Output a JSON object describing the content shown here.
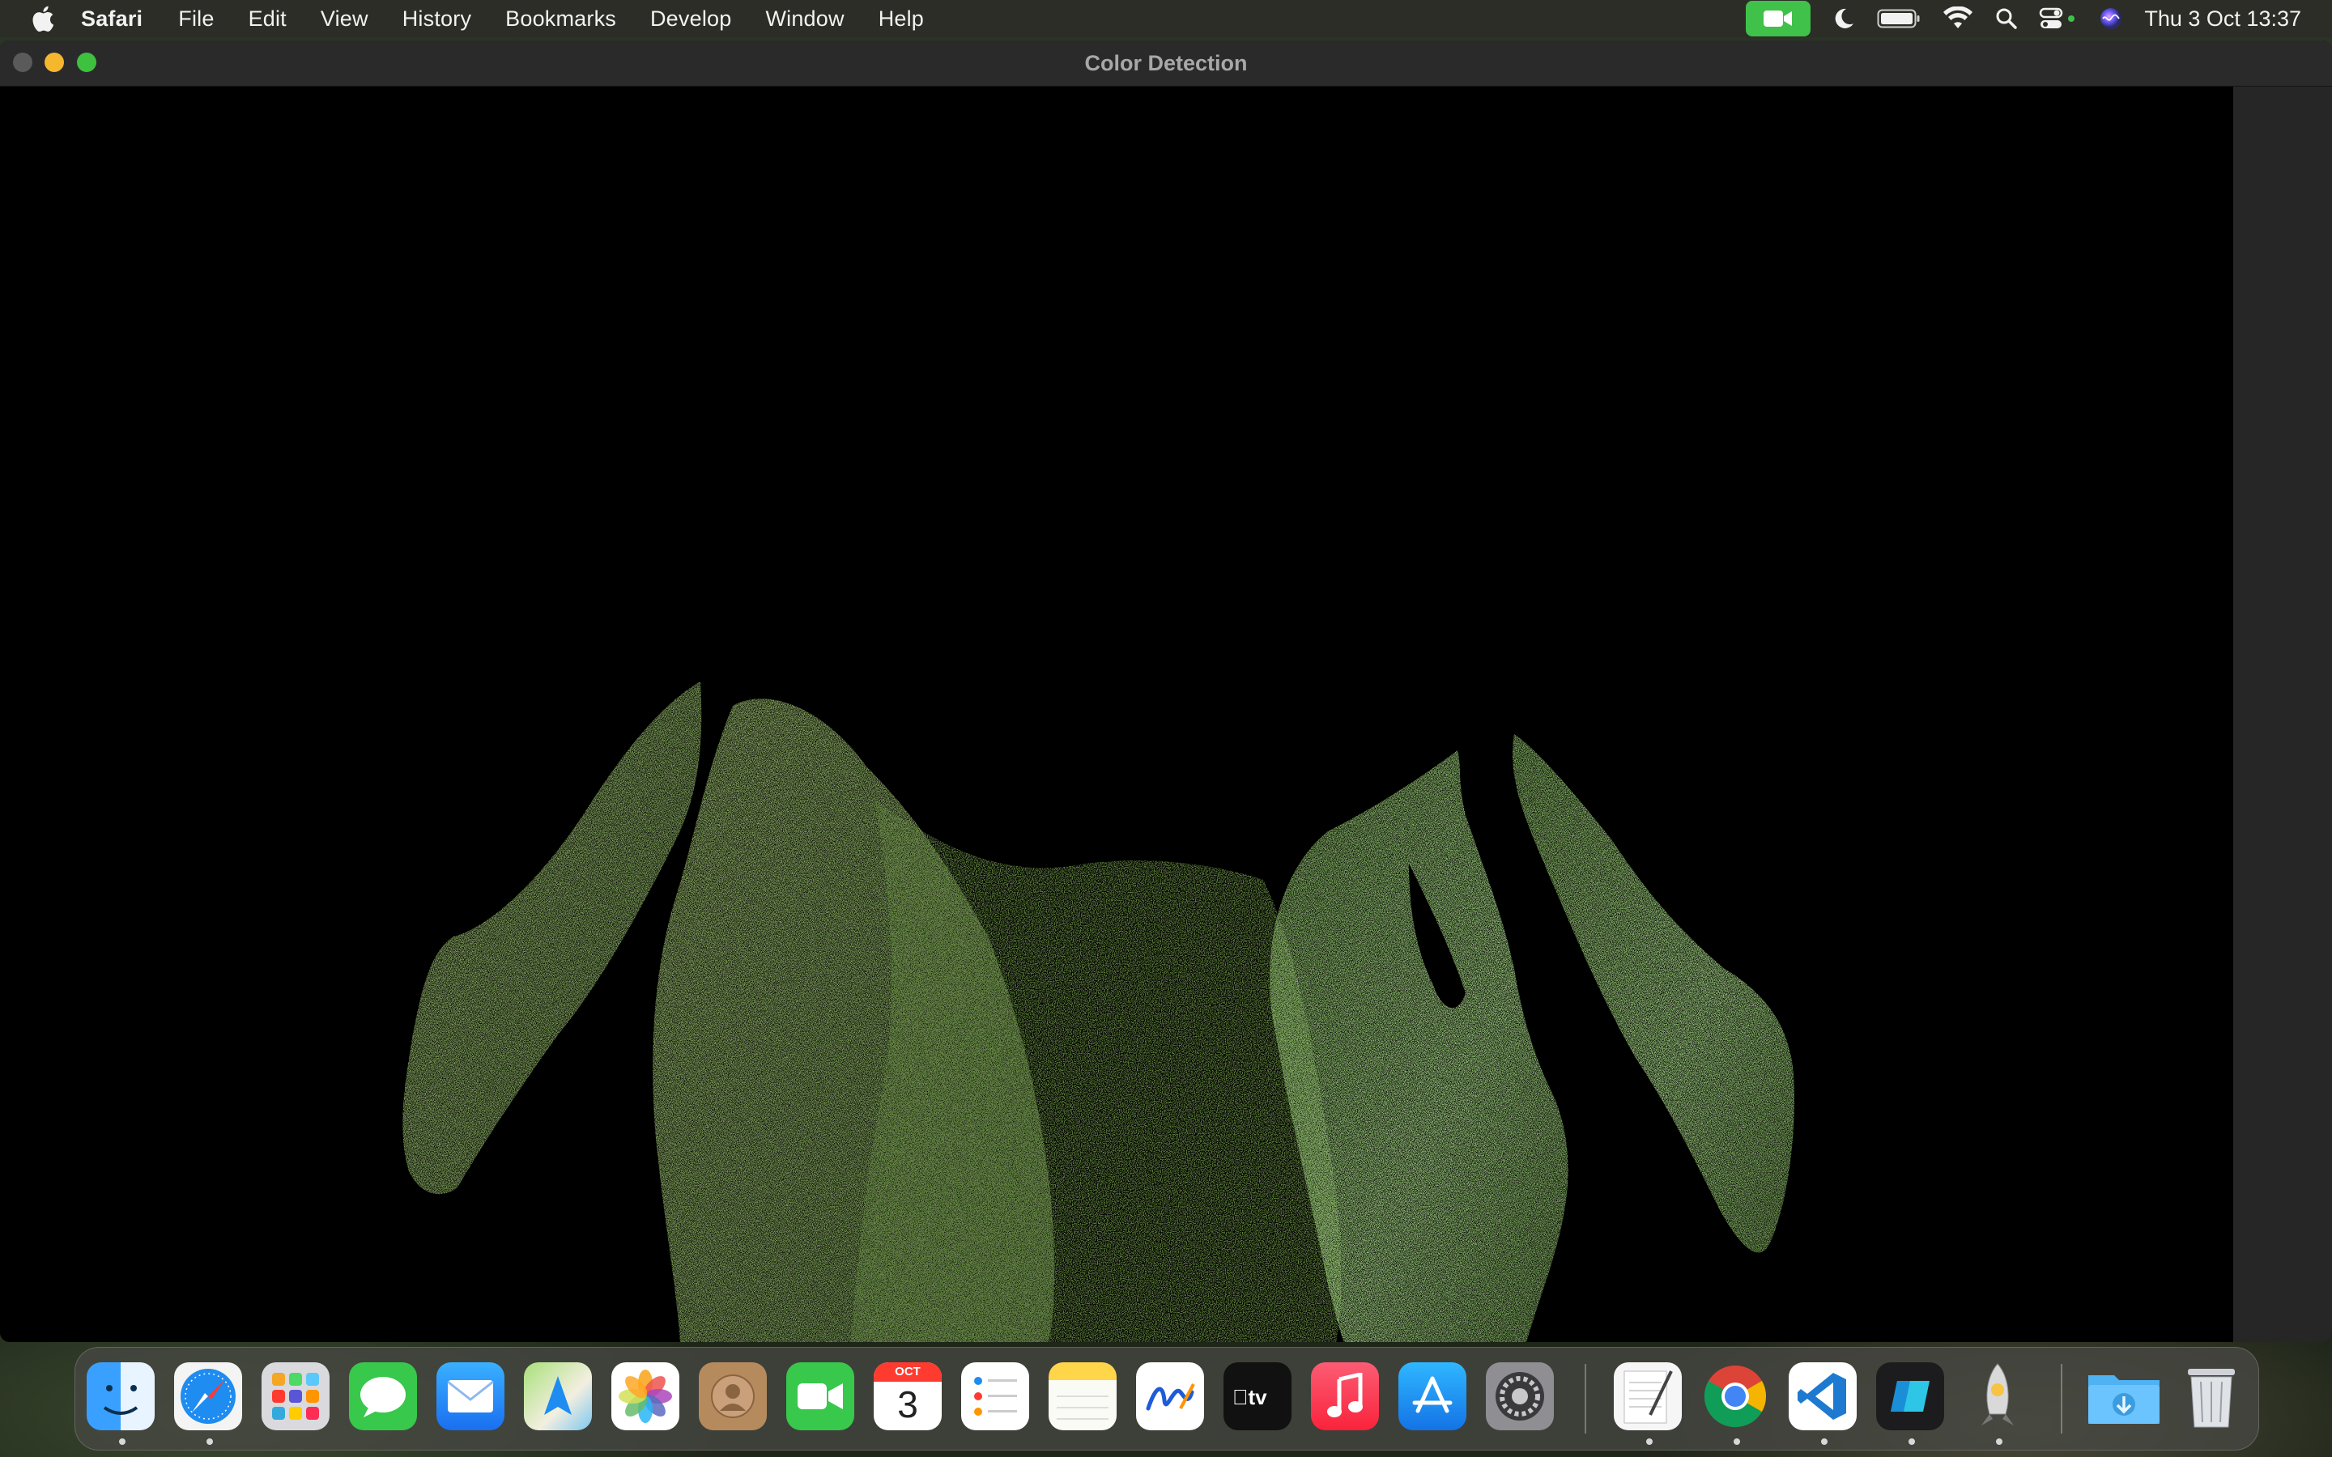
{
  "menubar": {
    "app_name": "Safari",
    "items": [
      "File",
      "Edit",
      "View",
      "History",
      "Bookmarks",
      "Develop",
      "Window",
      "Help"
    ],
    "clock": "Thu 3 Oct  13:37",
    "status_icons": [
      "facetime-active-icon",
      "moon-icon",
      "battery-icon",
      "wifi-icon",
      "search-icon",
      "control-center-icon",
      "siri-icon"
    ]
  },
  "window": {
    "title": "Color Detection",
    "content_description": "green-highlight-mask"
  },
  "dock": {
    "calendar_month": "OCT",
    "calendar_day": "3",
    "apps": [
      {
        "name": "Finder",
        "icon": "finder-icon",
        "running": true
      },
      {
        "name": "Safari",
        "icon": "safari-icon",
        "running": true
      },
      {
        "name": "Launchpad",
        "icon": "launchpad-icon",
        "running": false
      },
      {
        "name": "Messages",
        "icon": "messages-icon",
        "running": false
      },
      {
        "name": "Mail",
        "icon": "mail-icon",
        "running": false
      },
      {
        "name": "Maps",
        "icon": "maps-icon",
        "running": false
      },
      {
        "name": "Photos",
        "icon": "photos-icon",
        "running": false
      },
      {
        "name": "Contacts",
        "icon": "contacts-icon",
        "running": false
      },
      {
        "name": "FaceTime",
        "icon": "facetime-icon",
        "running": false
      },
      {
        "name": "Calendar",
        "icon": "calendar-icon",
        "running": false
      },
      {
        "name": "Reminders",
        "icon": "reminders-icon",
        "running": false
      },
      {
        "name": "Notes",
        "icon": "notes-icon",
        "running": false
      },
      {
        "name": "Freeform",
        "icon": "freeform-icon",
        "running": false
      },
      {
        "name": "TV",
        "icon": "tv-icon",
        "running": false
      },
      {
        "name": "Music",
        "icon": "music-icon",
        "running": false
      },
      {
        "name": "App Store",
        "icon": "app-store-icon",
        "running": false
      },
      {
        "name": "System Settings",
        "icon": "system-settings-icon",
        "running": false
      },
      {
        "name": "TextEdit",
        "icon": "textedit-icon",
        "running": true
      },
      {
        "name": "Google Chrome",
        "icon": "chrome-icon",
        "running": true
      },
      {
        "name": "Visual Studio Code",
        "icon": "vscode-icon",
        "running": true
      },
      {
        "name": "App",
        "icon": "blue-app-icon",
        "running": true
      },
      {
        "name": "Python Launcher",
        "icon": "python-rocket-icon",
        "running": true
      },
      {
        "name": "Downloads",
        "icon": "downloads-folder-icon",
        "running": false
      },
      {
        "name": "Trash",
        "icon": "trash-icon",
        "running": false
      }
    ]
  },
  "colors": {
    "mask_green": "#7fa85a",
    "menubar_bg": "#2b2d26",
    "window_bg": "#000000"
  }
}
